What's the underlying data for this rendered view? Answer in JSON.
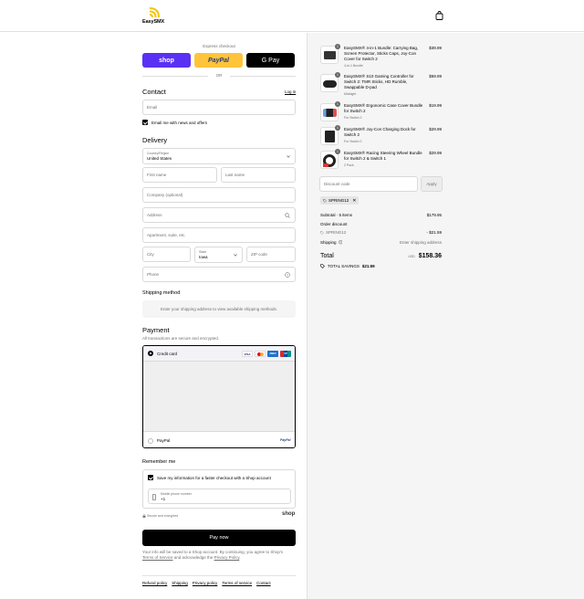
{
  "header": {
    "brand": "EasySMX",
    "cart_icon": "shopping-bag-icon"
  },
  "express": {
    "label": "Express checkout",
    "shop_label": "shop",
    "paypal_label": "PayPal",
    "gpay_label": "G Pay",
    "or_label": "OR"
  },
  "contact": {
    "title": "Contact",
    "login_label": "Log in",
    "email_placeholder": "Email",
    "newsletter_label": "Email me with news and offers"
  },
  "delivery": {
    "title": "Delivery",
    "country_label": "Country/Region",
    "country_value": "United States",
    "first_name_placeholder": "First name",
    "last_name_placeholder": "Last name",
    "company_placeholder": "Company (optional)",
    "address_placeholder": "Address",
    "apartment_placeholder": "Apartment, suite, etc.",
    "city_placeholder": "City",
    "state_label": "State",
    "state_value": "Iowa",
    "zip_placeholder": "ZIP code",
    "phone_placeholder": "Phone"
  },
  "shipping": {
    "title": "Shipping method",
    "notice": "Enter your shipping address to view available shipping methods."
  },
  "payment": {
    "title": "Payment",
    "subtitle": "All transactions are secure and encrypted.",
    "credit_card_label": "Credit card",
    "card_brands": [
      "VISA",
      "MC",
      "AMEX",
      "UP"
    ],
    "paypal_label": "PayPal",
    "paypal_logo": "PayPal"
  },
  "remember": {
    "title": "Remember me",
    "save_label": "Save my information for a faster checkout with a Shop account",
    "mobile_label": "Mobile phone number",
    "mobile_value": "+1",
    "secure_label": "Secure and encrypted",
    "shop_logo": "shop"
  },
  "pay_button": "Pay now",
  "legal": {
    "text": "Your info will be saved to a Shop account. By continuing, you agree to Shop's",
    "terms": "Terms of Service",
    "and": "and acknowledge the",
    "privacy": "Privacy Policy"
  },
  "footer_links": [
    "Refund policy",
    "Shipping",
    "Privacy policy",
    "Terms of service",
    "Contact"
  ],
  "products": [
    {
      "name": "EasySMX® 4-in-1 Bundle: Carrying Bag, Screen Protector, Sticks Caps, Joy-Con Cover for Switch 2",
      "variant": "4-in-1 Bundle",
      "price": "$39.99",
      "qty": "1"
    },
    {
      "name": "EasySMX® S10 Gaming Controller for Switch 2: TMR Sticks, HD Rumble, Swappable D-pad",
      "variant": "Midnight",
      "price": "$59.99",
      "qty": "1"
    },
    {
      "name": "EasySMX® Ergonomic Case Cover Bundle for Switch 2",
      "variant": "For Switch 2",
      "price": "$19.99",
      "qty": "1"
    },
    {
      "name": "EasySMX® Joy-Con Charging Dock for Switch 2",
      "variant": "For Switch 2",
      "price": "$29.99",
      "qty": "1"
    },
    {
      "name": "EasySMX® Racing Steering Wheel Bundle for Switch 2 & Switch 1",
      "variant": "2 Pack",
      "price": "$29.99",
      "qty": "1"
    }
  ],
  "discount": {
    "placeholder": "Discount code",
    "apply_label": "Apply",
    "code": "SPRING12"
  },
  "summary": {
    "subtotal_label": "Subtotal · 5 items",
    "subtotal_value": "$179.95",
    "order_discount_label": "Order discount",
    "discount_code": "SPRING12",
    "discount_value": "- $21.59",
    "shipping_label": "Shipping",
    "shipping_value": "Enter shipping address",
    "total_label": "Total",
    "currency": "USD",
    "total_value": "$158.36",
    "savings_label": "TOTAL SAVINGS",
    "savings_value": "$21.59"
  }
}
